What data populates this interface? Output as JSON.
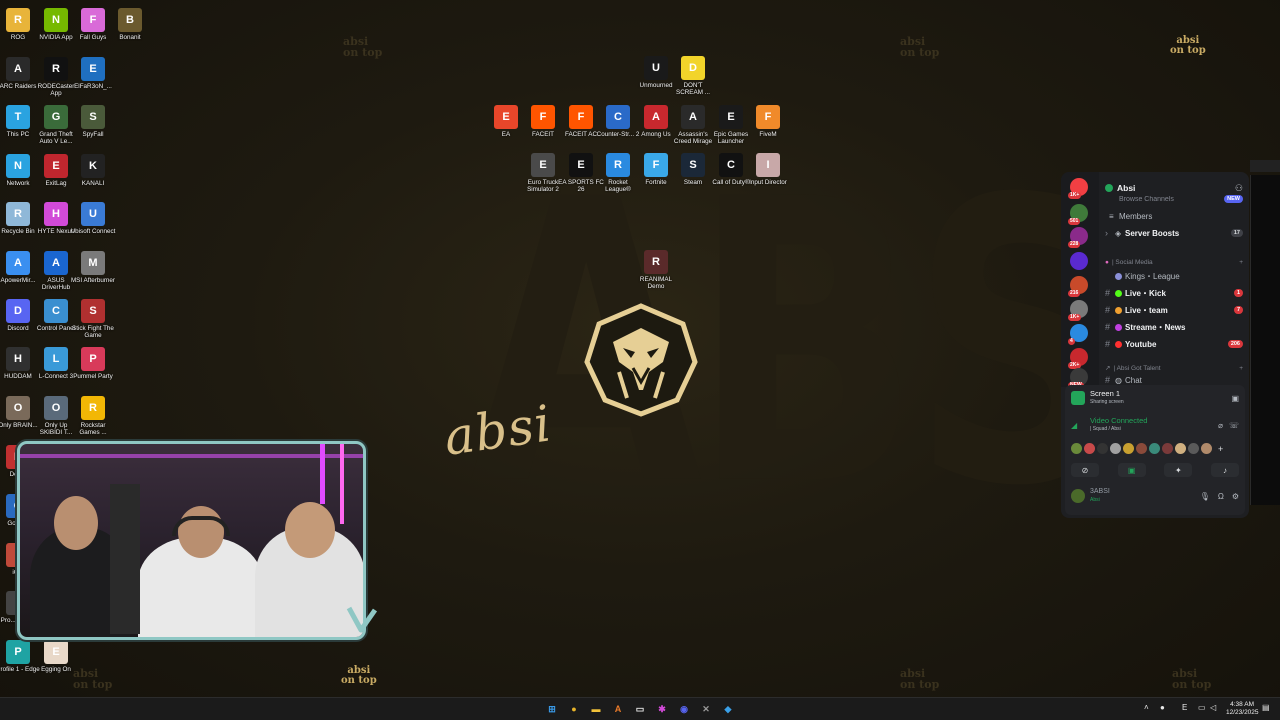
{
  "desktop_icons": [
    {
      "label": "ROG",
      "icon": "folder-icon",
      "color": "#e8b43a"
    },
    {
      "label": "NVIDIA App",
      "icon": "nvidia-icon",
      "color": "#76b900"
    },
    {
      "label": "Fall Guys",
      "icon": "fall-guys-icon",
      "color": "#d96ad8"
    },
    {
      "label": "Bonanit",
      "icon": "bonanit-icon",
      "color": "#6b5a2e"
    },
    {
      "label": "ARC Raiders",
      "icon": "arc-raiders-icon",
      "color": "#2a2a2a"
    },
    {
      "label": "RODECaster App",
      "icon": "rodecaster-icon",
      "color": "#111111"
    },
    {
      "label": "ElFaR3oN_...",
      "icon": "file-icon",
      "color": "#1f6fc0"
    },
    {
      "label": "This PC",
      "icon": "computer-icon",
      "color": "#2aa3e0"
    },
    {
      "label": "Grand Theft Auto V Le...",
      "icon": "gta-icon",
      "color": "#3a6b3a"
    },
    {
      "label": "SpyFall",
      "icon": "spyfall-icon",
      "color": "#4a5a3a"
    },
    {
      "label": "Network",
      "icon": "network-icon",
      "color": "#2aa3e0"
    },
    {
      "label": "ExitLag",
      "icon": "exitlag-icon",
      "color": "#c0262e"
    },
    {
      "label": "KANALI",
      "icon": "kanali-icon",
      "color": "#222222"
    },
    {
      "label": "Recycle Bin",
      "icon": "recycle-bin-icon",
      "color": "#8fb8d8"
    },
    {
      "label": "HYTE Nexus",
      "icon": "hyte-nexus-icon",
      "color": "#d24ad8"
    },
    {
      "label": "Ubisoft Connect",
      "icon": "ubisoft-icon",
      "color": "#3a7bd5"
    },
    {
      "label": "ApowerMir...",
      "icon": "apowermirror-icon",
      "color": "#3a8ff0"
    },
    {
      "label": "ASUS DriverHub",
      "icon": "asus-driverhub-icon",
      "color": "#1a66d0"
    },
    {
      "label": "MSI Afterburner",
      "icon": "msi-afterburner-icon",
      "color": "#7a7a7a"
    },
    {
      "label": "Discord",
      "icon": "discord-icon",
      "color": "#5865f2"
    },
    {
      "label": "Control Panel",
      "icon": "control-panel-icon",
      "color": "#3a8fd0"
    },
    {
      "label": "Stick Fight The Game",
      "icon": "stick-fight-icon",
      "color": "#b03030"
    },
    {
      "label": "HUDDAM",
      "icon": "huddam-icon",
      "color": "#303030"
    },
    {
      "label": "L-Connect 3",
      "icon": "l-connect-icon",
      "color": "#3a9ad8"
    },
    {
      "label": "Pummel Party",
      "icon": "pummel-party-icon",
      "color": "#d83a5a"
    },
    {
      "label": "Only BRAIN...",
      "icon": "game-icon",
      "color": "#7a6a5a"
    },
    {
      "label": "Only Up SKIBIDI T...",
      "icon": "game-icon",
      "color": "#5a6a7a"
    },
    {
      "label": "Rockstar Games ...",
      "icon": "rockstar-icon",
      "color": "#f2b705"
    },
    {
      "label": "Dou...",
      "icon": "app-icon",
      "color": "#c03030"
    },
    {
      "label": "GoXL...",
      "icon": "app-icon",
      "color": "#2a6ac0"
    },
    {
      "label": "iC...",
      "icon": "app-icon",
      "color": "#c04a3a"
    },
    {
      "label": "Pro... Unki...",
      "icon": "app-icon",
      "color": "#444444"
    },
    {
      "label": "Profile 1 - Edge",
      "icon": "edge-icon",
      "color": "#1fa3a3"
    },
    {
      "label": "Egging On",
      "icon": "egging-on-icon",
      "color": "#e8d8c8"
    },
    {
      "label": "Unmourned",
      "icon": "unmourned-icon",
      "color": "#1a1a1a"
    },
    {
      "label": "DON'T SCREAM ...",
      "icon": "dont-scream-icon",
      "color": "#f2d42a"
    },
    {
      "label": "EA",
      "icon": "ea-icon",
      "color": "#e8462a"
    },
    {
      "label": "FACEIT",
      "icon": "faceit-icon",
      "color": "#ff5500"
    },
    {
      "label": "FACEIT AC",
      "icon": "faceit-ac-icon",
      "color": "#ff5500"
    },
    {
      "label": "Counter-Str... 2",
      "icon": "counter-strike-icon",
      "color": "#2a6ac8"
    },
    {
      "label": "Among Us",
      "icon": "among-us-icon",
      "color": "#c8282e"
    },
    {
      "label": "Assassin's Creed Mirage",
      "icon": "assassins-creed-icon",
      "color": "#2a2a2a"
    },
    {
      "label": "Epic Games Launcher",
      "icon": "epic-games-icon",
      "color": "#1a1a1a"
    },
    {
      "label": "FiveM",
      "icon": "fivem-icon",
      "color": "#f08a2a"
    },
    {
      "label": "Euro Truck Simulator 2",
      "icon": "euro-truck-icon",
      "color": "#4a4a4a"
    },
    {
      "label": "EA SPORTS FC 26",
      "icon": "ea-fc-icon",
      "color": "#111111"
    },
    {
      "label": "Rocket League®",
      "icon": "rocket-league-icon",
      "color": "#2a8ae0"
    },
    {
      "label": "Fortnite",
      "icon": "fortnite-icon",
      "color": "#3aa8e8"
    },
    {
      "label": "Steam",
      "icon": "steam-icon",
      "color": "#1b2838"
    },
    {
      "label": "Call of Duty®",
      "icon": "call-of-duty-icon",
      "color": "#111111"
    },
    {
      "label": "Input Director",
      "icon": "input-director-icon",
      "color": "#c8a8a8"
    },
    {
      "label": "REANIMAL Demo",
      "icon": "reanimal-icon",
      "color": "#5a2a2a"
    }
  ],
  "wallpaper": {
    "watermark": "ABSI",
    "signature": "absi",
    "brand_line1": "absi",
    "brand_line2": "on top",
    "accent": "#d9c08a"
  },
  "discord": {
    "server_name": "Absi",
    "servers": [
      {
        "badge": "1K+",
        "color": "#f23f43",
        "icon": "discord-home-icon"
      },
      {
        "badge": "501",
        "color": "#3f7a3a",
        "icon": "server-icon"
      },
      {
        "badge": "228",
        "color": "#8a2a8a",
        "icon": "server-icon"
      },
      {
        "badge": "",
        "color": "#5a2ad0",
        "icon": "server-icon"
      },
      {
        "badge": "216",
        "color": "#c84a2a",
        "icon": "server-icon"
      },
      {
        "badge": "1K+",
        "color": "#7a7a7a",
        "icon": "server-icon"
      },
      {
        "badge": "4",
        "color": "#2a8ae0",
        "icon": "server-icon"
      },
      {
        "badge": "2K+",
        "color": "#c8282e",
        "icon": "server-icon"
      },
      {
        "badge": "NEW",
        "color": "#3a3a3a",
        "icon": "server-icon"
      }
    ],
    "top_rows": {
      "browse": "Browse Channels",
      "browse_badge": "NEW",
      "members": "Members",
      "boosts": "Server Boosts",
      "boosts_count": "17"
    },
    "category_social": "| Social Media",
    "channels": [
      {
        "name": "Kings・League",
        "count": "",
        "bold": false,
        "dot": "#8a8fd8"
      },
      {
        "name": "Live・Kick",
        "count": "1",
        "bold": true,
        "dot": "#53fc18"
      },
      {
        "name": "Live・team",
        "count": "7",
        "bold": true,
        "dot": "#f0a030"
      },
      {
        "name": "Streame・News",
        "count": "",
        "bold": true,
        "dot": "#c040e0"
      },
      {
        "name": "Youtube",
        "count": "206",
        "bold": true,
        "dot": "#ff3030"
      }
    ],
    "category_talent": "| Absi Got Talent",
    "chat_channel": "Chat",
    "voice": {
      "screen_title": "Screen 1",
      "screen_sub": "Sharing screen",
      "status": "Video Connected",
      "status_sub": "| Squad / Absi",
      "user_name": "3ABSI",
      "user_sub": "Absi"
    }
  },
  "taskbar": {
    "icons": [
      {
        "icon": "windows-start-icon",
        "color": "#3a9ae8",
        "glyph": "⊞"
      },
      {
        "icon": "chrome-icon",
        "color": "#e8b42a",
        "glyph": "●"
      },
      {
        "icon": "file-explorer-icon",
        "color": "#f2c23a",
        "glyph": "▬"
      },
      {
        "icon": "app-a-icon",
        "color": "#e87a2a",
        "glyph": "A"
      },
      {
        "icon": "app-window-icon",
        "color": "#e8e8e8",
        "glyph": "▭"
      },
      {
        "icon": "hyte-icon",
        "color": "#d24ad8",
        "glyph": "✱"
      },
      {
        "icon": "discord-taskbar-icon",
        "color": "#5865f2",
        "glyph": "◉"
      },
      {
        "icon": "xbox-icon",
        "color": "#9a9a9a",
        "glyph": "✕"
      },
      {
        "icon": "steam-taskbar-icon",
        "color": "#3aa0e8",
        "glyph": "◆"
      }
    ],
    "tray_lang": "E",
    "time": "4:38 AM",
    "date": "12/23/2025"
  }
}
